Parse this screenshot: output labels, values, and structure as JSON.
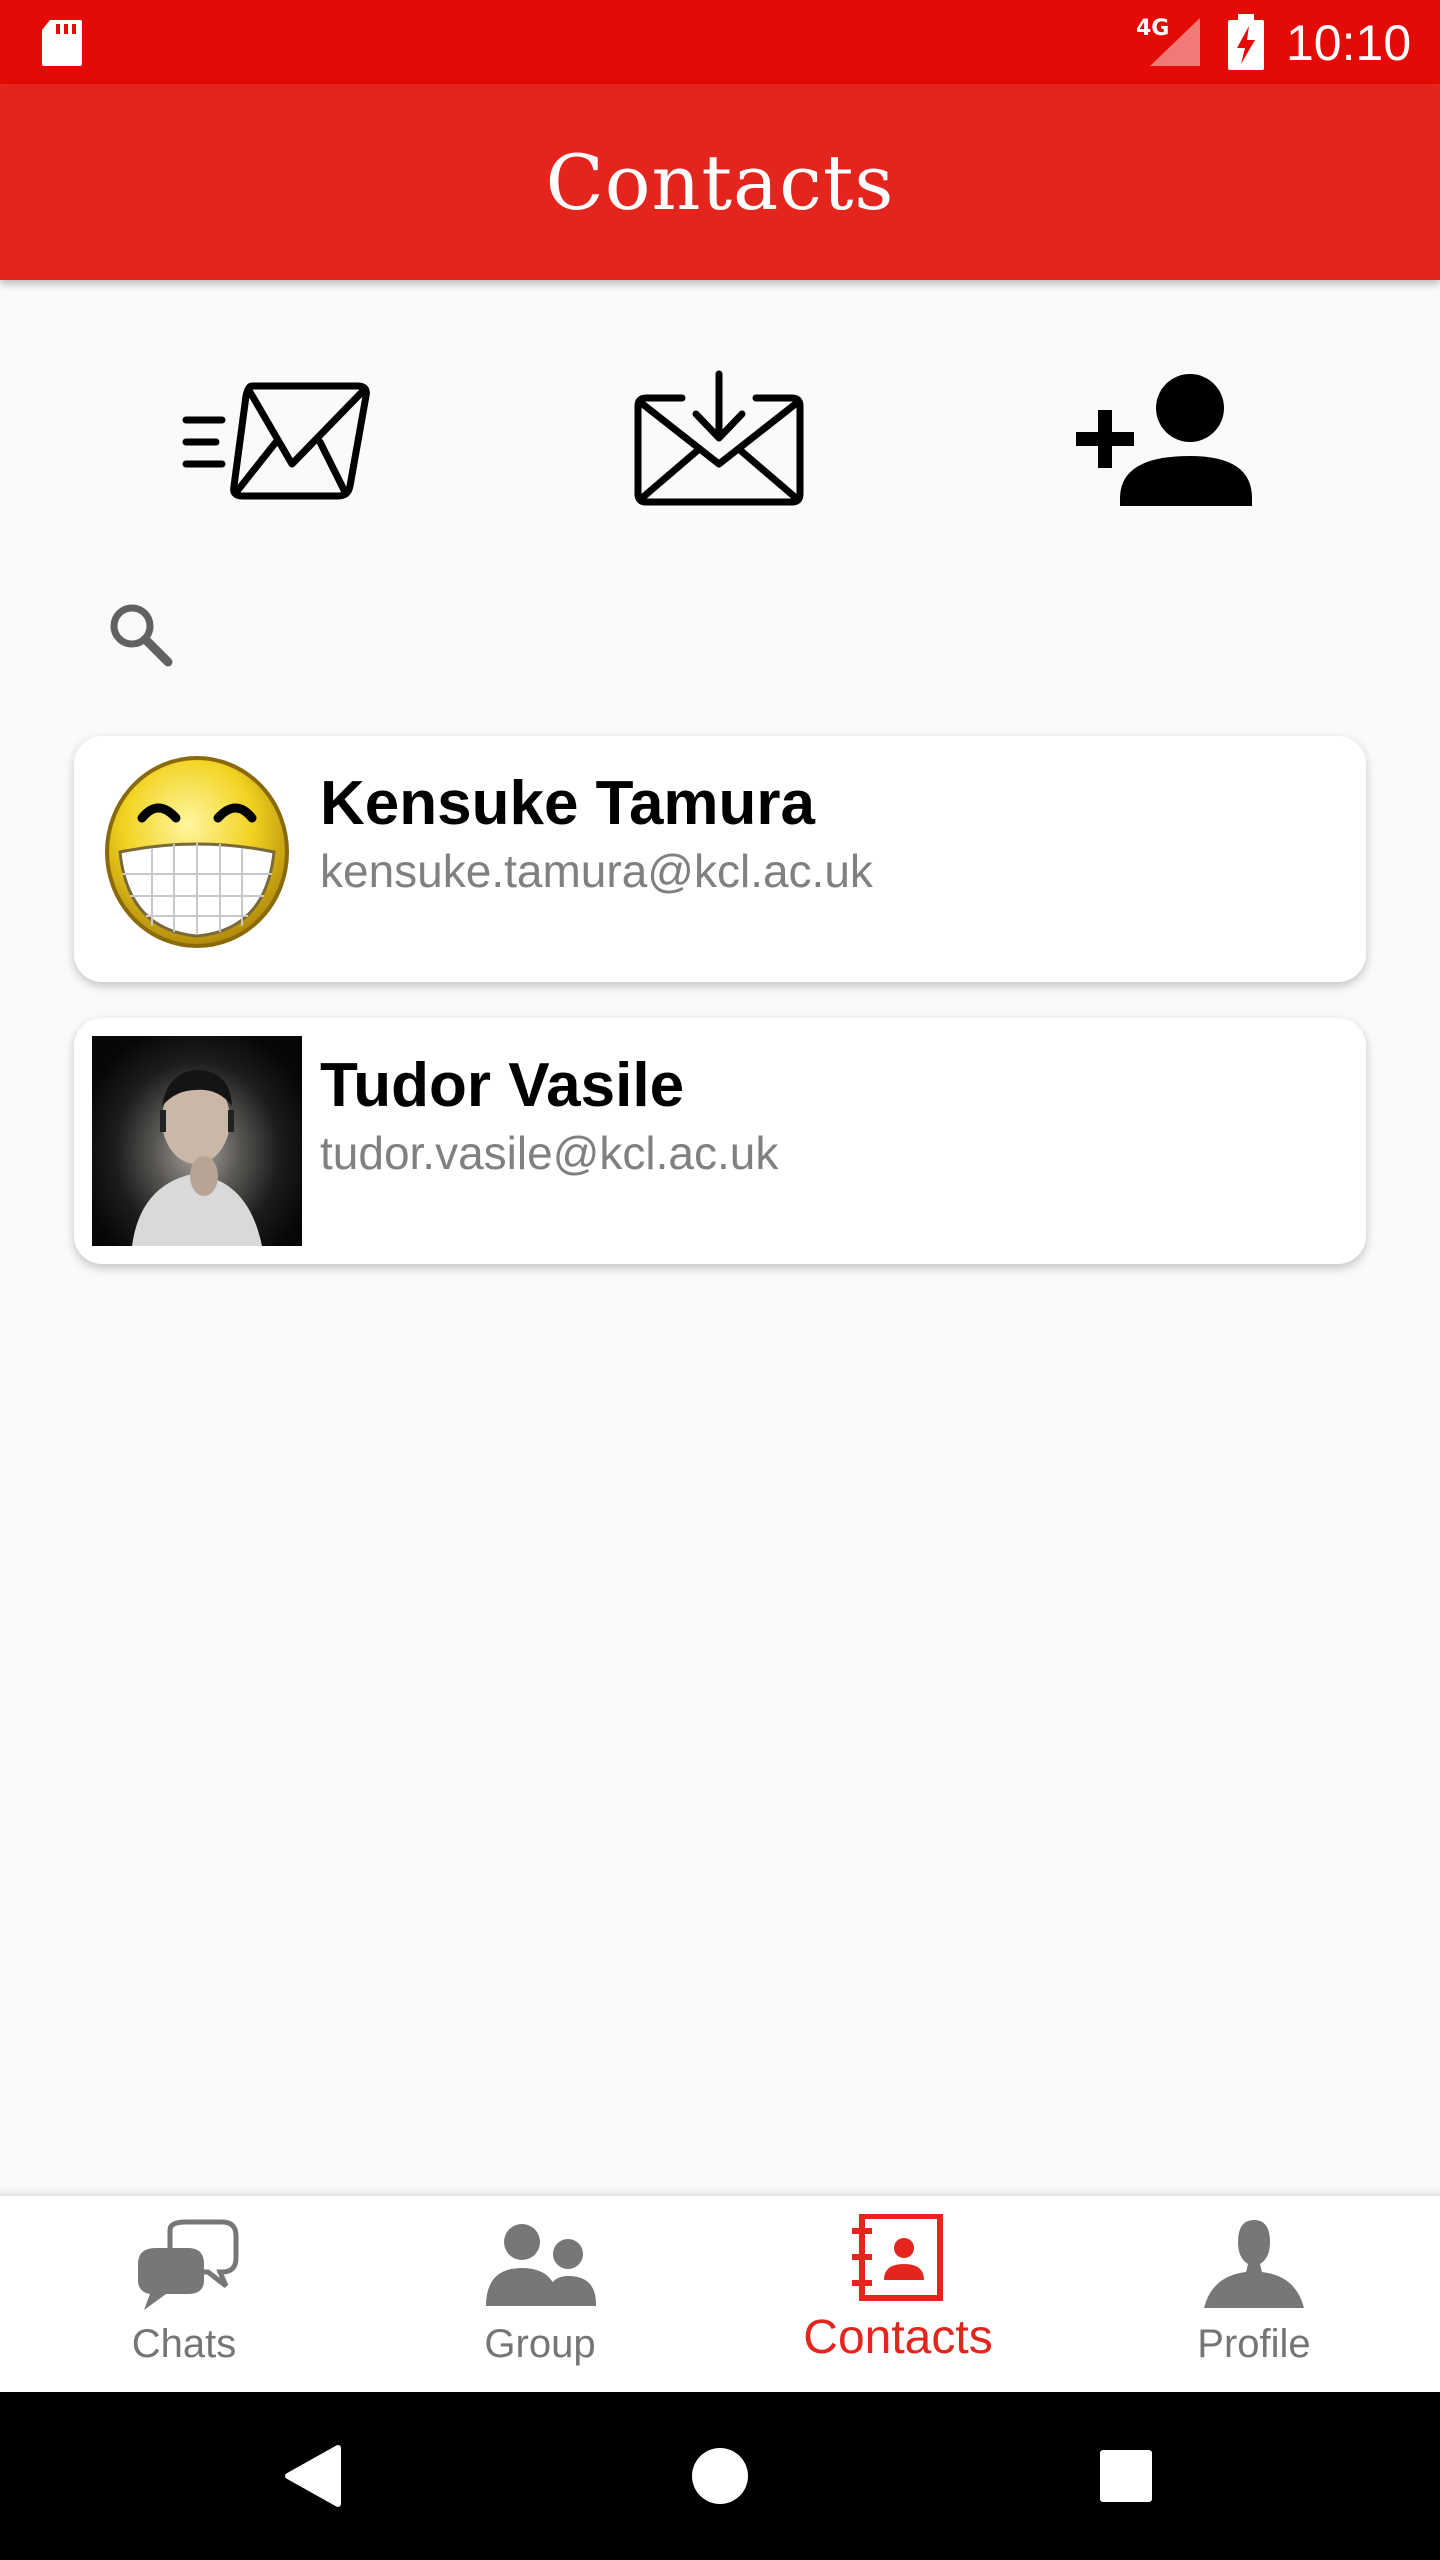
{
  "status_bar": {
    "network": "4G",
    "time": "10:10"
  },
  "app_bar": {
    "title": "Contacts"
  },
  "actions": [
    {
      "icon": "send-mail-icon"
    },
    {
      "icon": "inbox-download-icon"
    },
    {
      "icon": "add-person-icon"
    }
  ],
  "search": {
    "icon": "search-icon",
    "placeholder": ""
  },
  "contacts": [
    {
      "name": "Kensuke Tamura",
      "email": "kensuke.tamura@kcl.ac.uk",
      "avatar": "smiley-avatar"
    },
    {
      "name": "Tudor Vasile",
      "email": "tudor.vasile@kcl.ac.uk",
      "avatar": "photo-avatar"
    }
  ],
  "bottom_nav": {
    "items": [
      {
        "label": "Chats",
        "icon": "chat-bubbles-icon"
      },
      {
        "label": "Group",
        "icon": "group-icon"
      },
      {
        "label": "Contacts",
        "icon": "contact-book-icon",
        "active": true
      },
      {
        "label": "Profile",
        "icon": "person-icon"
      }
    ]
  },
  "colors": {
    "status_bar": "#e40b06",
    "app_bar": "#e3251e",
    "accent": "#e3251e",
    "inactive_nav": "#757575",
    "secondary_text": "#808080"
  }
}
